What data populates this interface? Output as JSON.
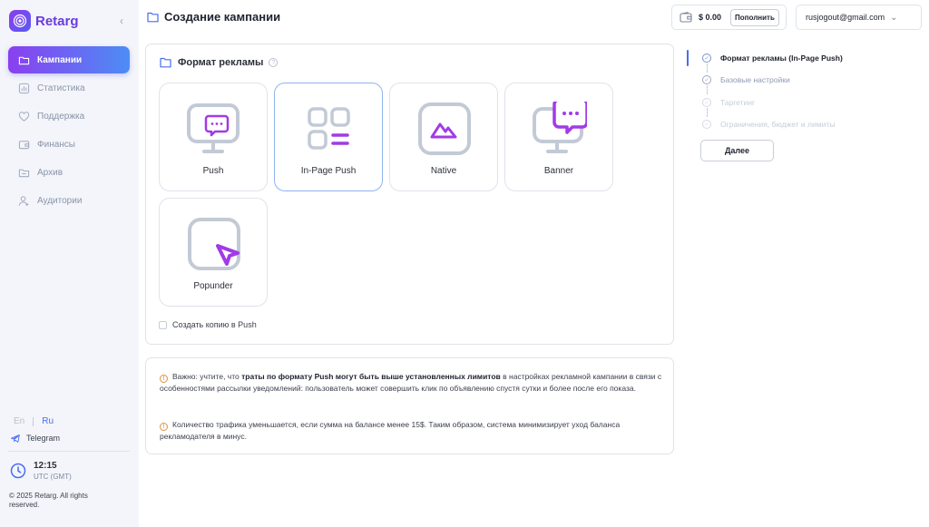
{
  "app": {
    "name": "Retarg",
    "brand_color": "#6a3be0"
  },
  "sidebar": {
    "items": [
      {
        "label": "Кампании",
        "icon": "folder-icon",
        "active": true
      },
      {
        "label": "Статистика",
        "icon": "chart-icon",
        "active": false
      },
      {
        "label": "Поддержка",
        "icon": "heart-icon",
        "active": false
      },
      {
        "label": "Финансы",
        "icon": "wallet-icon",
        "active": false
      },
      {
        "label": "Архив",
        "icon": "archive-icon",
        "active": false
      },
      {
        "label": "Аудитории",
        "icon": "user-add-icon",
        "active": false
      }
    ],
    "lang_en": "En",
    "lang_ru": "Ru",
    "telegram": "Telegram",
    "time": "12:15",
    "timezone": "UTC (GMT)",
    "copyright": "© 2025 Retarg. All rights reserved."
  },
  "header": {
    "title": "Создание кампании",
    "balance": "$ 0.00",
    "topup_label": "Пополнить",
    "user_email": "rusjogout@gmail.com"
  },
  "format": {
    "title": "Формат рекламы",
    "options": [
      {
        "label": "Push",
        "icon": "push-monitor-icon",
        "selected": false
      },
      {
        "label": "In-Page Push",
        "icon": "grid-list-icon",
        "selected": true
      },
      {
        "label": "Native",
        "icon": "image-icon",
        "selected": false
      },
      {
        "label": "Banner",
        "icon": "banner-monitor-icon",
        "selected": false
      },
      {
        "label": "Popunder",
        "icon": "cursor-window-icon",
        "selected": false
      }
    ],
    "copy_label": "Создать копию в Push"
  },
  "info": {
    "note1_pre": "Важно: учтите, что ",
    "note1_bold": "траты по формату Push могут быть выше установленных лимитов",
    "note1_post": " в настройках рекламной кампании в связи с особенностями рассылки уведомлений: пользователь может совершить клик по объявлению спустя сутки и более после его показа.",
    "note2": "Количество трафика уменьшается, если сумма на балансе менее 15$. Таким образом, система минимизирует уход баланса рекламодателя в минус."
  },
  "steps": {
    "items": [
      {
        "label": "Формат рекламы (In-Page Push)",
        "state": "current"
      },
      {
        "label": "Базовые настройки",
        "state": "next"
      },
      {
        "label": "Таргетинг",
        "state": "disabled"
      },
      {
        "label": "Ограничения, бюджет и лимиты",
        "state": "disabled"
      }
    ],
    "next_label": "Далее"
  },
  "colors": {
    "accent": "#4a6cf0",
    "purple": "#a13be6",
    "icon_gray": "#c3cad6"
  }
}
